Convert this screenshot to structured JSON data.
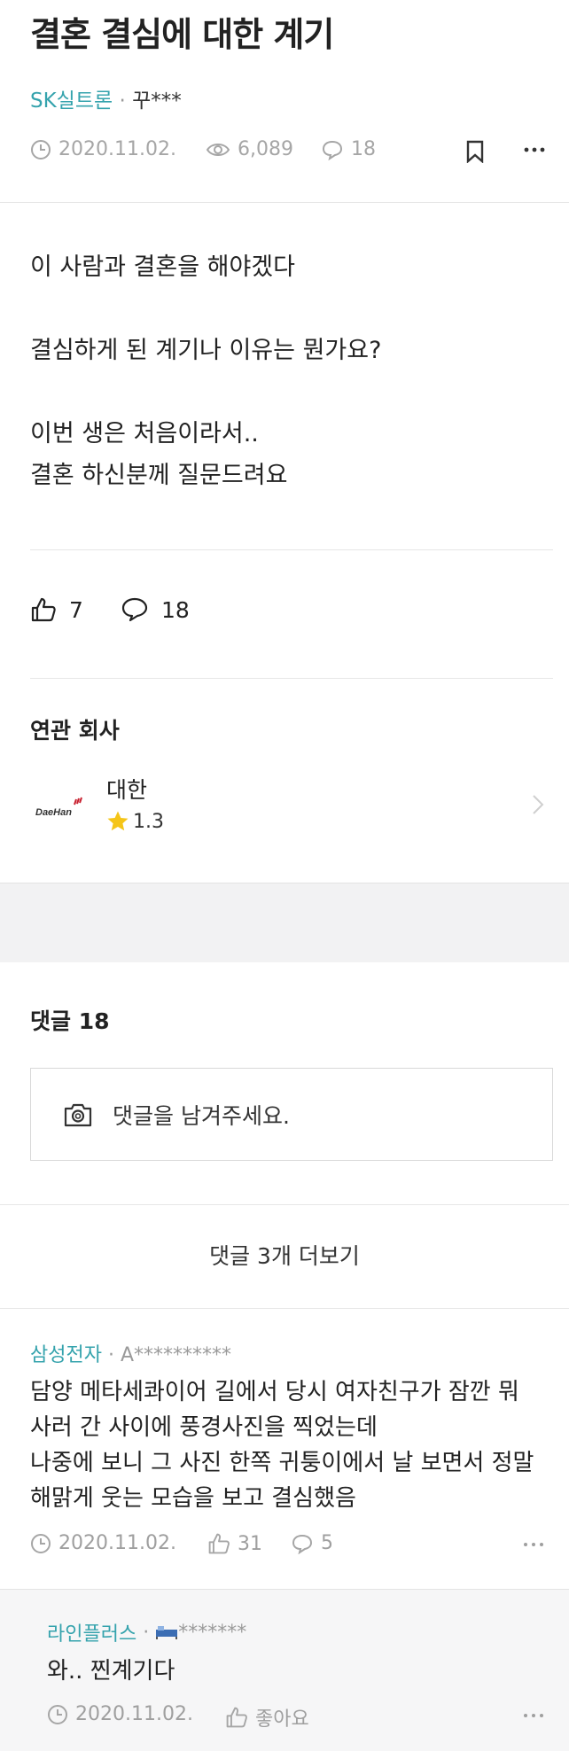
{
  "post": {
    "title": "결혼 결심에 대한 계기",
    "company": "SK실트론",
    "author": "꾸***",
    "date": "2020.11.02.",
    "views": "6,089",
    "comment_count": "18",
    "body": [
      "이 사람과 결혼을 해야겠다",
      "결심하게 된 계기나 이유는 뭔가요?",
      "이번 생은 처음이라서..",
      "결혼 하신분께 질문드려요"
    ],
    "likes": "7",
    "comments": "18"
  },
  "related": {
    "section_title": "연관 회사",
    "company_name": "대한",
    "logo_text": "DaeHan",
    "rating": "1.3"
  },
  "comments_section": {
    "title": "댓글 18",
    "input_placeholder": "댓글을 남겨주세요.",
    "more_label": "댓글 3개 더보기"
  },
  "comment": {
    "company": "삼성전자",
    "author": "A**********",
    "lines": [
      "담양 메타세콰이어 길에서 당시 여자친구가 잠깐 뭐",
      "사러 간 사이에 풍경사진을 찍었는데",
      "나중에 보니 그 사진 한쪽 귀퉁이에서 날 보면서 정말",
      "해맑게 웃는 모습을 보고 결심했음"
    ],
    "date": "2020.11.02.",
    "likes": "31",
    "replies": "5"
  },
  "reply": {
    "company": "라인플러스",
    "author": "*******",
    "text": "와.. 찐계기다",
    "date": "2020.11.02.",
    "like_label": "좋아요"
  },
  "colors": {
    "accent": "#35a3ad",
    "star": "#f5c518",
    "logo_red": "#c8202f"
  },
  "icons": [
    "clock-icon",
    "eye-icon",
    "comment-icon",
    "bookmark-icon",
    "more-icon",
    "thumbs-up-icon",
    "star-icon",
    "chevron-right-icon",
    "camera-icon",
    "bed-icon"
  ]
}
